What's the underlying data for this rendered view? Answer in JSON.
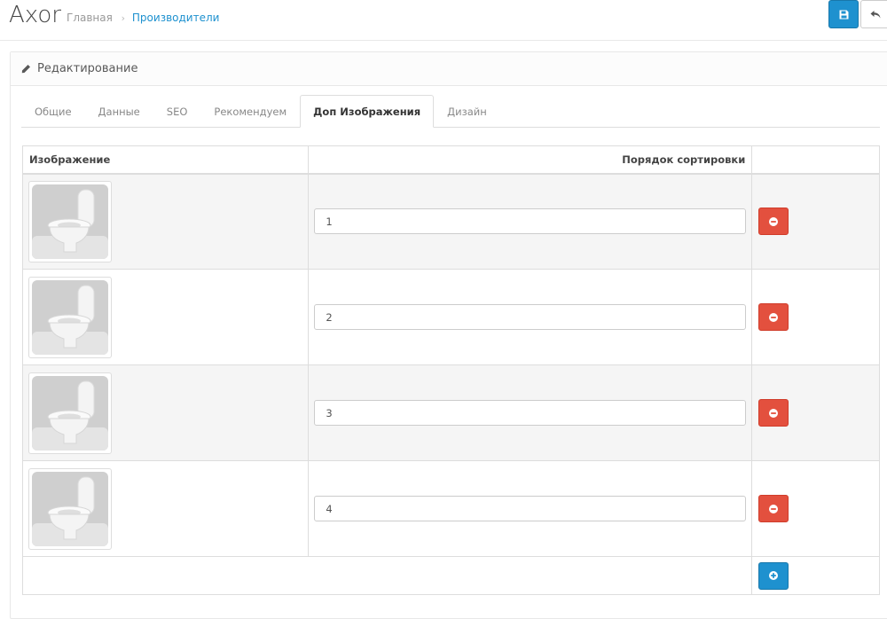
{
  "header": {
    "title": "Axor",
    "breadcrumb": {
      "home": "Главная",
      "separator": "›",
      "current": "Производители"
    },
    "save_icon": "save-icon",
    "back_icon": "reply-icon"
  },
  "panel": {
    "heading": "Редактирование",
    "heading_icon": "pencil-icon"
  },
  "tabs": [
    {
      "label": "Общие",
      "active": false
    },
    {
      "label": "Данные",
      "active": false
    },
    {
      "label": "SEO",
      "active": false
    },
    {
      "label": "Рекомендуем",
      "active": false
    },
    {
      "label": "Доп Изображения",
      "active": true
    },
    {
      "label": "Дизайн",
      "active": false
    }
  ],
  "table": {
    "columns": [
      "Изображение",
      "Порядок сортировки",
      ""
    ],
    "rows": [
      {
        "image": "toilet-image",
        "sort_order": "1"
      },
      {
        "image": "toilet-image",
        "sort_order": "2"
      },
      {
        "image": "toilet-image",
        "sort_order": "3"
      },
      {
        "image": "toilet-image",
        "sort_order": "4"
      }
    ],
    "remove_icon": "minus-circle-icon",
    "add_icon": "plus-circle-icon"
  },
  "colors": {
    "primary": "#1e91cf",
    "danger": "#e3503e",
    "link": "#1e91cf"
  }
}
